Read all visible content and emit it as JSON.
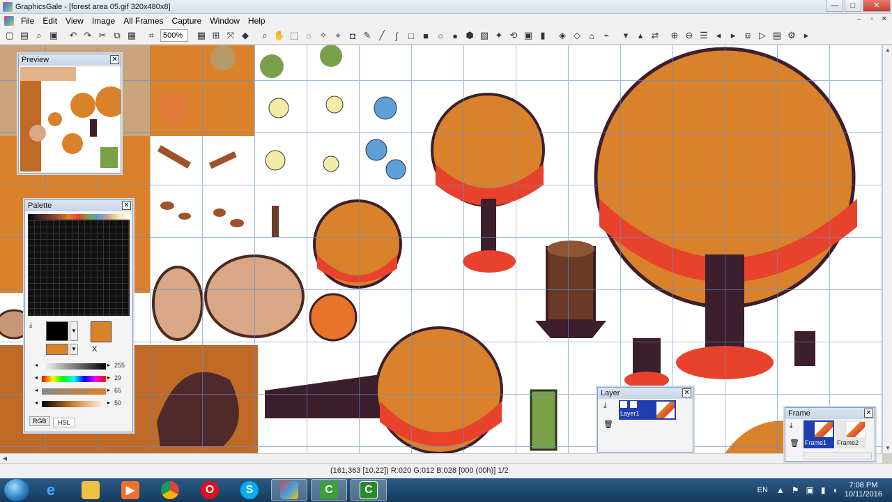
{
  "window": {
    "title": "GraphicsGale - [forest area 05.gif 320x480x8]",
    "minimize": "—",
    "maximize": "□",
    "close": "✕"
  },
  "menu": {
    "items": [
      "File",
      "Edit",
      "View",
      "Image",
      "All Frames",
      "Capture",
      "Window",
      "Help"
    ],
    "mdi_minimize": "–",
    "mdi_restore": "▫",
    "mdi_close": "✕"
  },
  "toolbar": {
    "zoom": "500%"
  },
  "status": {
    "text": "(161,363 [10,22]) R:020 G:012 B:028 [000 (00h)] 1/2"
  },
  "preview": {
    "title": "Preview",
    "close": "✕"
  },
  "palette": {
    "title": "Palette",
    "close": "✕",
    "values": [
      "255",
      "29",
      "65",
      "50"
    ],
    "tabs": [
      "RGB",
      "HSL"
    ],
    "active_tab": "HSL",
    "x_label": "X"
  },
  "layer": {
    "title": "Layer",
    "close": "✕",
    "layers": [
      "Layer1"
    ]
  },
  "frame": {
    "title": "Frame",
    "close": "✕",
    "frames": [
      "Frame1",
      "Frame2"
    ]
  },
  "taskbar": {
    "apps": [
      "internet-explorer",
      "file-explorer",
      "media-player",
      "chrome",
      "opera",
      "skype",
      "graphicsgale",
      "camtasia",
      "camtasia-recorder"
    ],
    "lang": "EN",
    "time": "7:08 PM",
    "date": "10/11/2016"
  },
  "colors": {
    "foreground": "#000000",
    "background": "#d9822b",
    "leaf_orange": "#d9822b",
    "leaf_red": "#e8412c",
    "trunk": "#3c1e2c",
    "grid": "#5f8fd8"
  }
}
